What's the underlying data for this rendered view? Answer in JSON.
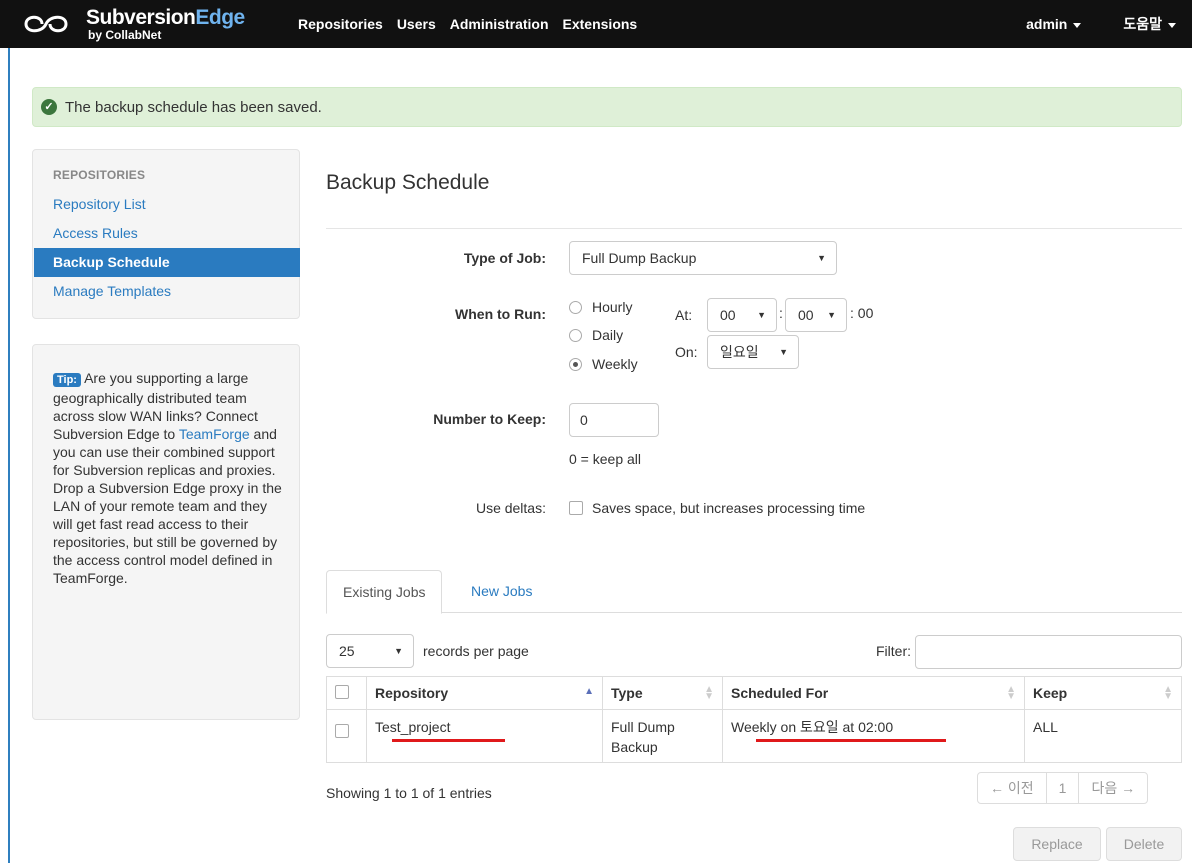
{
  "navbar": {
    "logo_main": "Subversion",
    "logo_edge": "Edge",
    "logo_sub": "by CollabNet",
    "links": [
      "Repositories",
      "Users",
      "Administration",
      "Extensions"
    ],
    "user_menu": "admin",
    "help_menu": "도움말"
  },
  "alert": {
    "message": "The backup schedule has been saved."
  },
  "sidebar": {
    "heading": "REPOSITORIES",
    "items": [
      "Repository List",
      "Access Rules",
      "Backup Schedule",
      "Manage Templates"
    ],
    "active": "Backup Schedule"
  },
  "tip": {
    "label": "Tip:",
    "text_before": "Are you supporting a large geographically distributed team across slow WAN links? Connect Subversion Edge to",
    "link": "TeamForge",
    "text_after": "and you can use their combined support for Subversion replicas and proxies. Drop a Subversion Edge proxy in the LAN of your remote team and they will get fast read access to their repositories, but still be governed by the access control model defined in TeamForge."
  },
  "form": {
    "title": "Backup Schedule",
    "type_label": "Type of Job:",
    "type_value": "Full Dump Backup",
    "when_label": "When to Run:",
    "when_options": [
      "Hourly",
      "Daily",
      "Weekly"
    ],
    "when_selected": "Weekly",
    "at_label": "At:",
    "hour": "00",
    "minute": "00",
    "seconds": ": 00",
    "colon": ":",
    "on_label": "On:",
    "day": "일요일",
    "keep_label": "Number to Keep:",
    "keep_value": "0",
    "keep_help": "0 = keep all",
    "deltas_label": "Use deltas:",
    "deltas_text": "Saves space, but increases processing time"
  },
  "tabs": [
    "Existing Jobs",
    "New Jobs"
  ],
  "table": {
    "page_size": "25",
    "records_label": "records per page",
    "filter_label": "Filter:",
    "headers": [
      "Repository",
      "Type",
      "Scheduled For",
      "Keep"
    ],
    "rows": [
      {
        "repository": "Test_project",
        "type": "Full Dump Backup",
        "scheduled": "Weekly on 토요일 at 02:00",
        "keep": "ALL"
      }
    ],
    "summary": "Showing 1 to 1 of 1 entries",
    "pager": {
      "prev": "← 이전",
      "page": "1",
      "next": "다음 →"
    }
  },
  "actions": {
    "replace": "Replace",
    "delete": "Delete"
  },
  "colors": {
    "accent": "#2a7bc0",
    "success_bg": "#dff0d8",
    "annotation": "#e0191b"
  }
}
